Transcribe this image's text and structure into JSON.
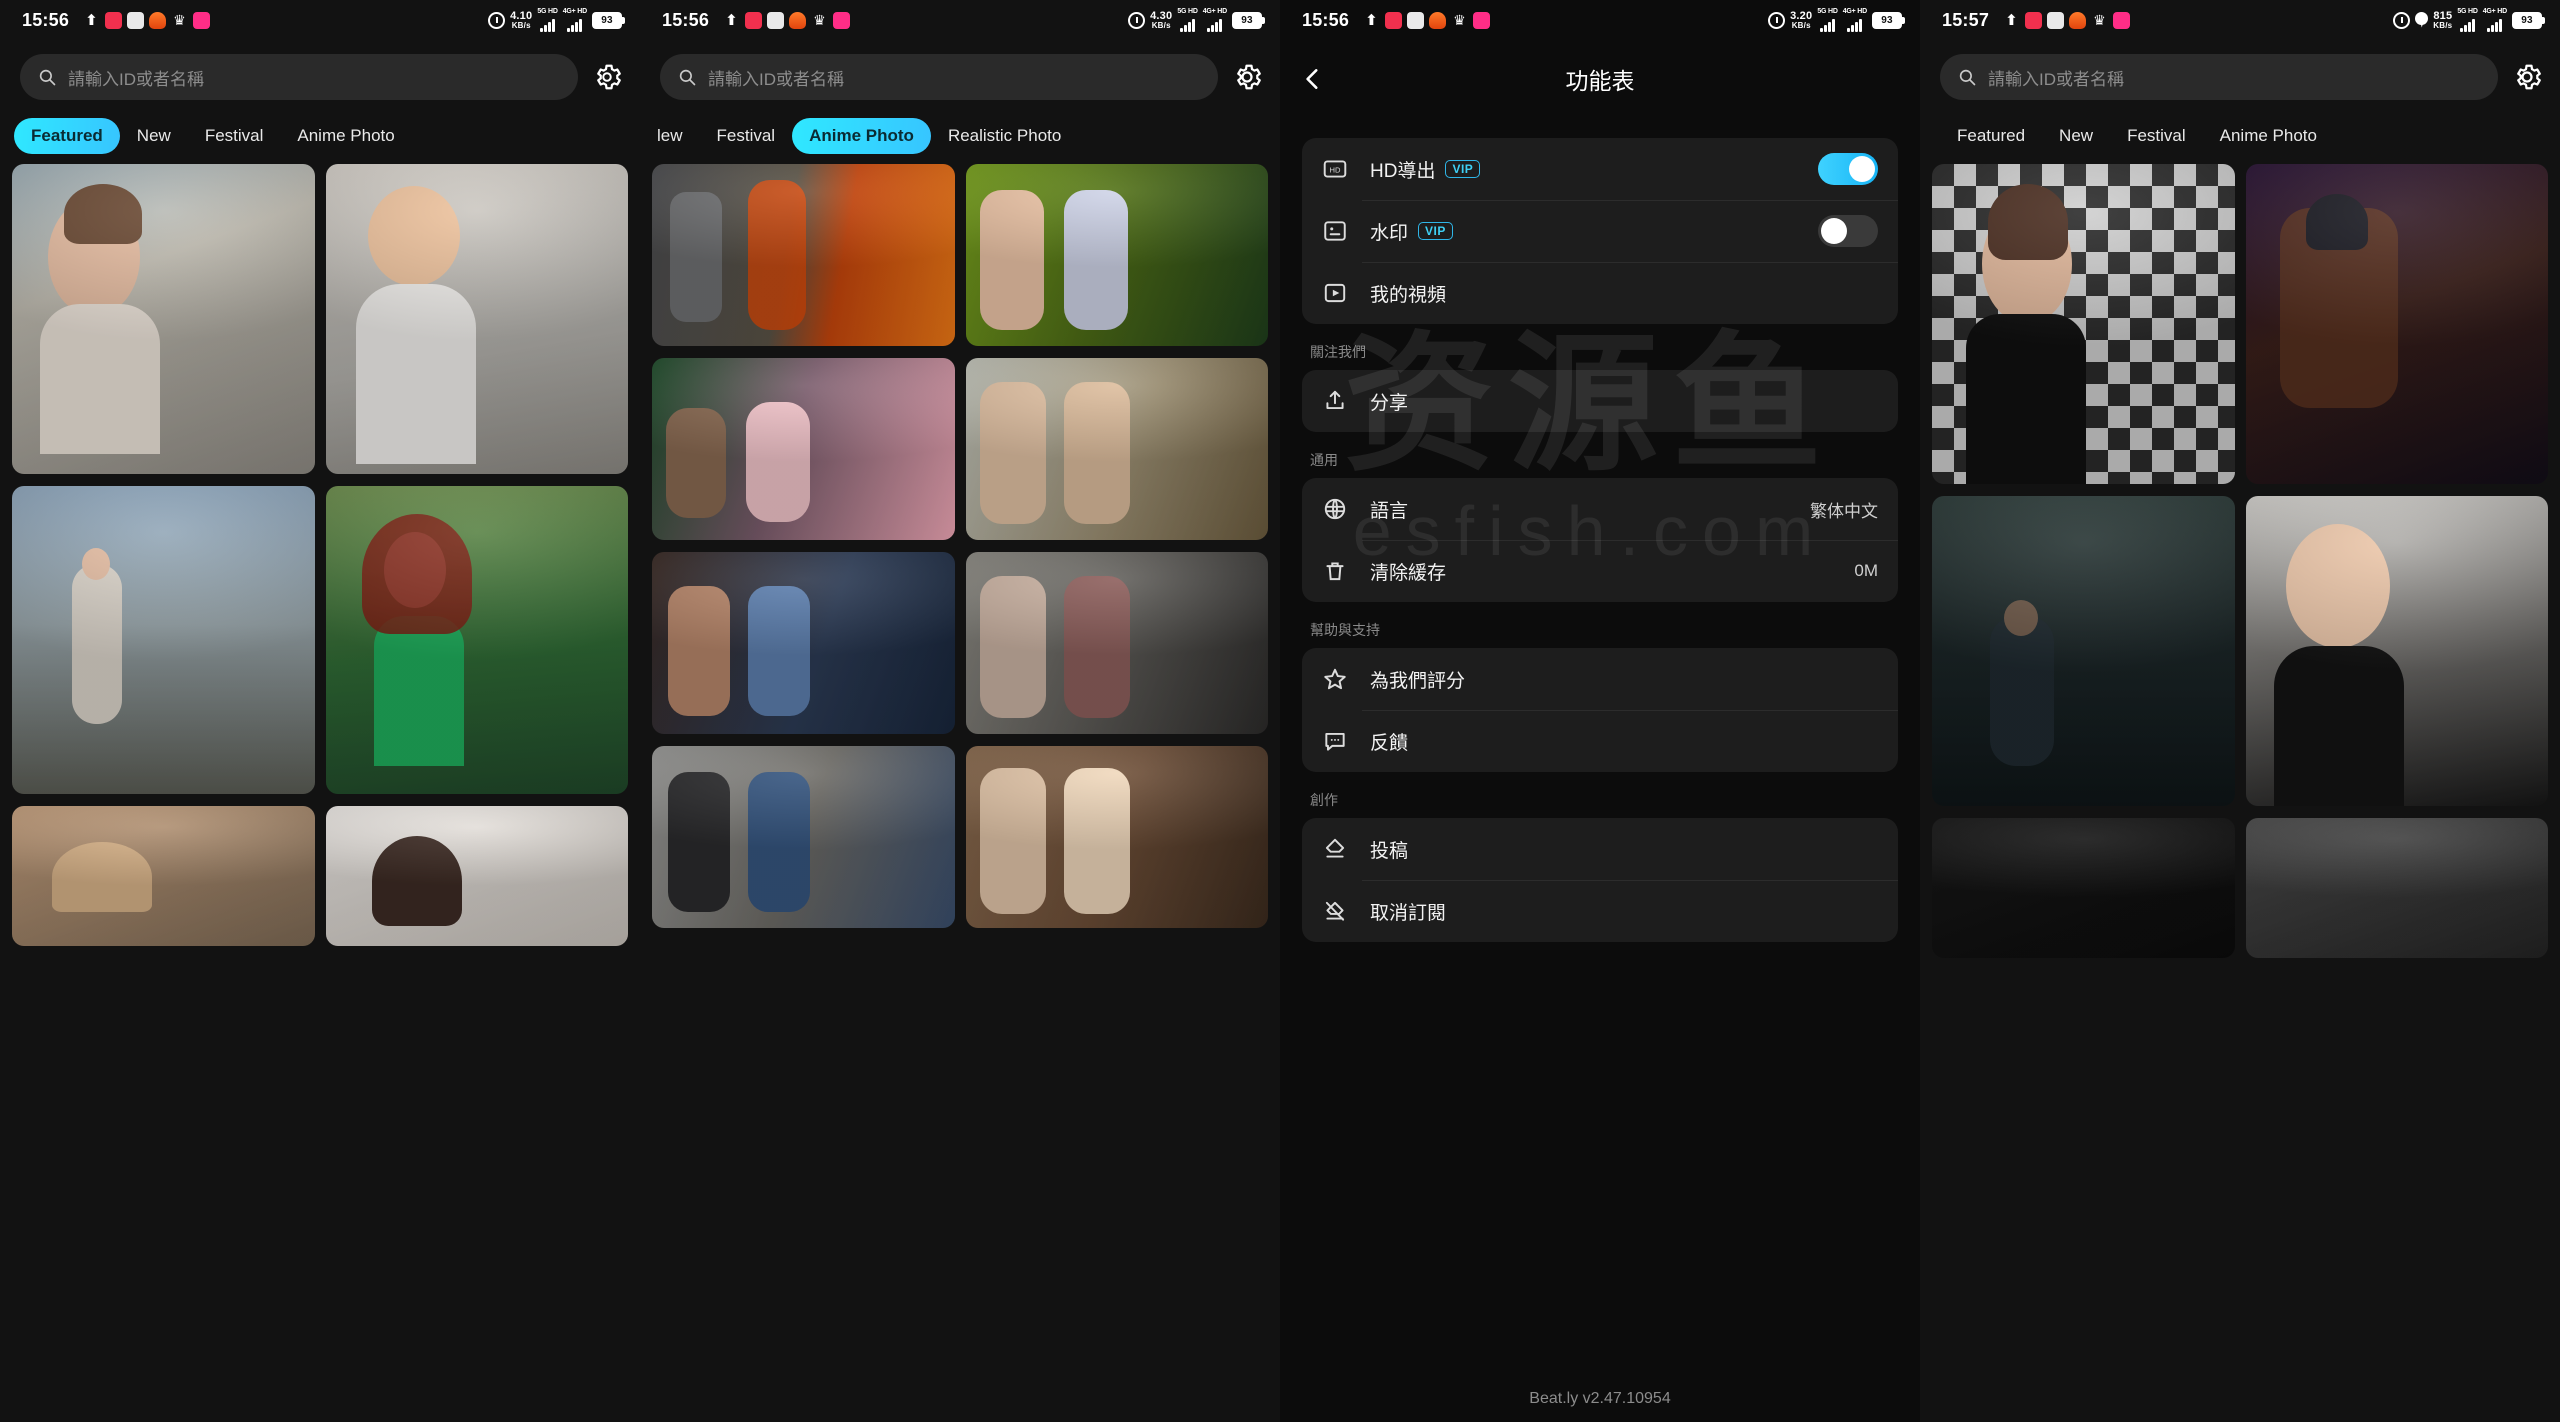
{
  "panels": [
    {
      "id": "home-featured",
      "status": {
        "time": "15:56",
        "speed_value": "4.10",
        "speed_unit": "KB/s",
        "net1": "5G HD",
        "net2": "4G+ HD",
        "battery": "93",
        "icons": [
          "upload-icon",
          "red-badge-icon",
          "gray-app-icon",
          "orange-app-icon",
          "crown-icon",
          "pink-app-icon"
        ]
      },
      "search": {
        "placeholder": "請輸入ID或者名稱",
        "icon": "search-icon",
        "gear": "gear-icon"
      },
      "tabs": [
        {
          "label": "Featured",
          "active": true
        },
        {
          "label": "New",
          "active": false
        },
        {
          "label": "Festival",
          "active": false
        },
        {
          "label": "Anime Photo",
          "active": false
        }
      ]
    },
    {
      "id": "home-anime",
      "status": {
        "time": "15:56",
        "speed_value": "4.30",
        "speed_unit": "KB/s",
        "net1": "5G HD",
        "net2": "4G+ HD",
        "battery": "93",
        "icons": [
          "upload-icon",
          "red-badge-icon",
          "gray-app-icon",
          "orange-app-icon",
          "crown-icon",
          "pink-app-icon"
        ]
      },
      "search": {
        "placeholder": "請輸入ID或者名稱",
        "icon": "search-icon",
        "gear": "gear-icon"
      },
      "tabs": [
        {
          "label": "lew",
          "active": false
        },
        {
          "label": "Festival",
          "active": false
        },
        {
          "label": "Anime Photo",
          "active": true
        },
        {
          "label": "Realistic Photo",
          "active": false
        }
      ]
    },
    {
      "id": "settings",
      "status": {
        "time": "15:56",
        "speed_value": "3.20",
        "speed_unit": "KB/s",
        "net1": "5G HD",
        "net2": "4G+ HD",
        "battery": "93",
        "icons": [
          "upload-icon",
          "red-badge-icon",
          "gray-app-icon",
          "orange-app-icon",
          "crown-icon",
          "pink-app-icon"
        ]
      },
      "header": {
        "back": "back-arrow-icon",
        "title": "功能表"
      },
      "version": "Beat.ly v2.47.10954",
      "watermark": {
        "cn": "资源鱼",
        "en": "esfish.com"
      },
      "groups": [
        {
          "label": "",
          "items": [
            {
              "icon": "hd-icon",
              "label": "HD導出",
              "badge": "VIP",
              "control": "toggle",
              "toggle_on": true
            },
            {
              "icon": "watermark-icon",
              "label": "水印",
              "badge": "VIP",
              "control": "toggle",
              "toggle_on": false
            },
            {
              "icon": "video-play-icon",
              "label": "我的視頻",
              "badge": "",
              "control": "none"
            }
          ]
        },
        {
          "label": "關注我們",
          "items": [
            {
              "icon": "share-icon",
              "label": "分享",
              "badge": "",
              "control": "none"
            }
          ]
        },
        {
          "label": "通用",
          "items": [
            {
              "icon": "globe-icon",
              "label": "語言",
              "badge": "",
              "control": "value",
              "value": "繁体中文"
            },
            {
              "icon": "trash-icon",
              "label": "清除緩存",
              "badge": "",
              "control": "value",
              "value": "0M"
            }
          ]
        },
        {
          "label": "幫助與支持",
          "items": [
            {
              "icon": "star-icon",
              "label": "為我們評分",
              "badge": "",
              "control": "none"
            },
            {
              "icon": "feedback-icon",
              "label": "反饋",
              "badge": "",
              "control": "none"
            }
          ]
        },
        {
          "label": "創作",
          "items": [
            {
              "icon": "pen-icon",
              "label": "投稿",
              "badge": "",
              "control": "none"
            },
            {
              "icon": "unsubscribe-icon",
              "label": "取消訂閱",
              "badge": "",
              "control": "none"
            }
          ]
        }
      ]
    },
    {
      "id": "home-featured-2",
      "status": {
        "time": "15:57",
        "speed_value": "815",
        "speed_unit": "KB/s",
        "net1": "5G HD",
        "net2": "4G+ HD",
        "battery": "93",
        "icons": [
          "upload-icon",
          "red-badge-icon",
          "gray-app-icon",
          "orange-app-icon",
          "crown-icon",
          "pink-app-icon"
        ],
        "location": true
      },
      "search": {
        "placeholder": "請輸入ID或者名稱",
        "icon": "search-icon",
        "gear": "gear-icon"
      },
      "tabs": [
        {
          "label": "Featured",
          "active": false
        },
        {
          "label": "New",
          "active": false
        },
        {
          "label": "Festival",
          "active": false
        },
        {
          "label": "Anime Photo",
          "active": false
        }
      ]
    }
  ],
  "colors": {
    "accent": "#35dcff",
    "vip": "#3fd0f5",
    "bg": "#121212",
    "card": "#1d1d1d"
  }
}
